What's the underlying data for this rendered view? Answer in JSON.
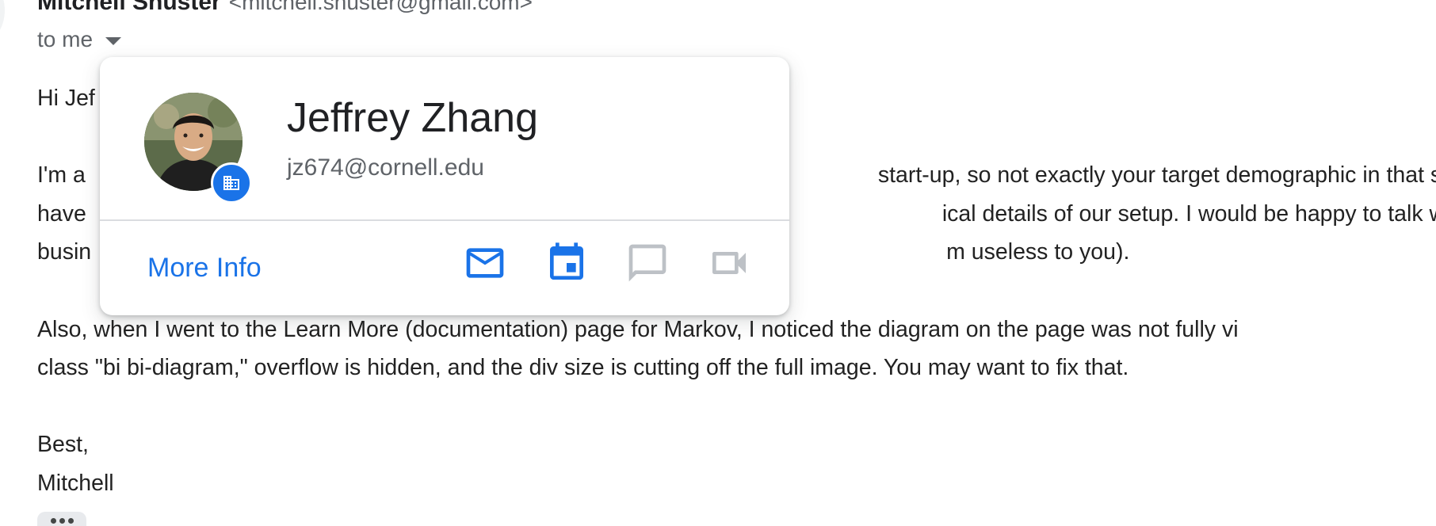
{
  "email": {
    "sender_name": "Mitchell Shuster",
    "sender_email": "<mitchell.shuster@gmail.com>",
    "recipient_line": "to me",
    "greeting": "Hi Jef",
    "paragraph1": [
      "I'm a",
      "have",
      "busin"
    ],
    "paragraph1_right": [
      "start-up, so not exactly your target demographic in that s",
      "ical details of our setup. I would be happy to talk with yo",
      "m useless to you)."
    ],
    "paragraph2": [
      "Also, when I went to the Learn More (documentation) page for Markov, I noticed the diagram on the page was not fully vi",
      "class \"bi bi-diagram,\" overflow is hidden, and the div size is cutting off the full image. You may want to fix that."
    ],
    "signoff": "Best,",
    "signature": "Mitchell"
  },
  "hovercard": {
    "name": "Jeffrey Zhang",
    "email": "jz674@cornell.edu",
    "more_info_label": "More Info",
    "badge_icon": "building-icon",
    "actions": [
      {
        "name": "send-email",
        "icon": "mail-icon",
        "color": "#1a73e8",
        "enabled": true
      },
      {
        "name": "schedule-event",
        "icon": "calendar-icon",
        "color": "#1a73e8",
        "enabled": true
      },
      {
        "name": "chat",
        "icon": "chat-icon",
        "color": "#bdc1c6",
        "enabled": false
      },
      {
        "name": "video-call",
        "icon": "video-icon",
        "color": "#bdc1c6",
        "enabled": false
      }
    ]
  },
  "colors": {
    "accent": "#1a73e8",
    "disabled": "#bdc1c6",
    "text": "#202124",
    "secondary_text": "#5f6368"
  }
}
